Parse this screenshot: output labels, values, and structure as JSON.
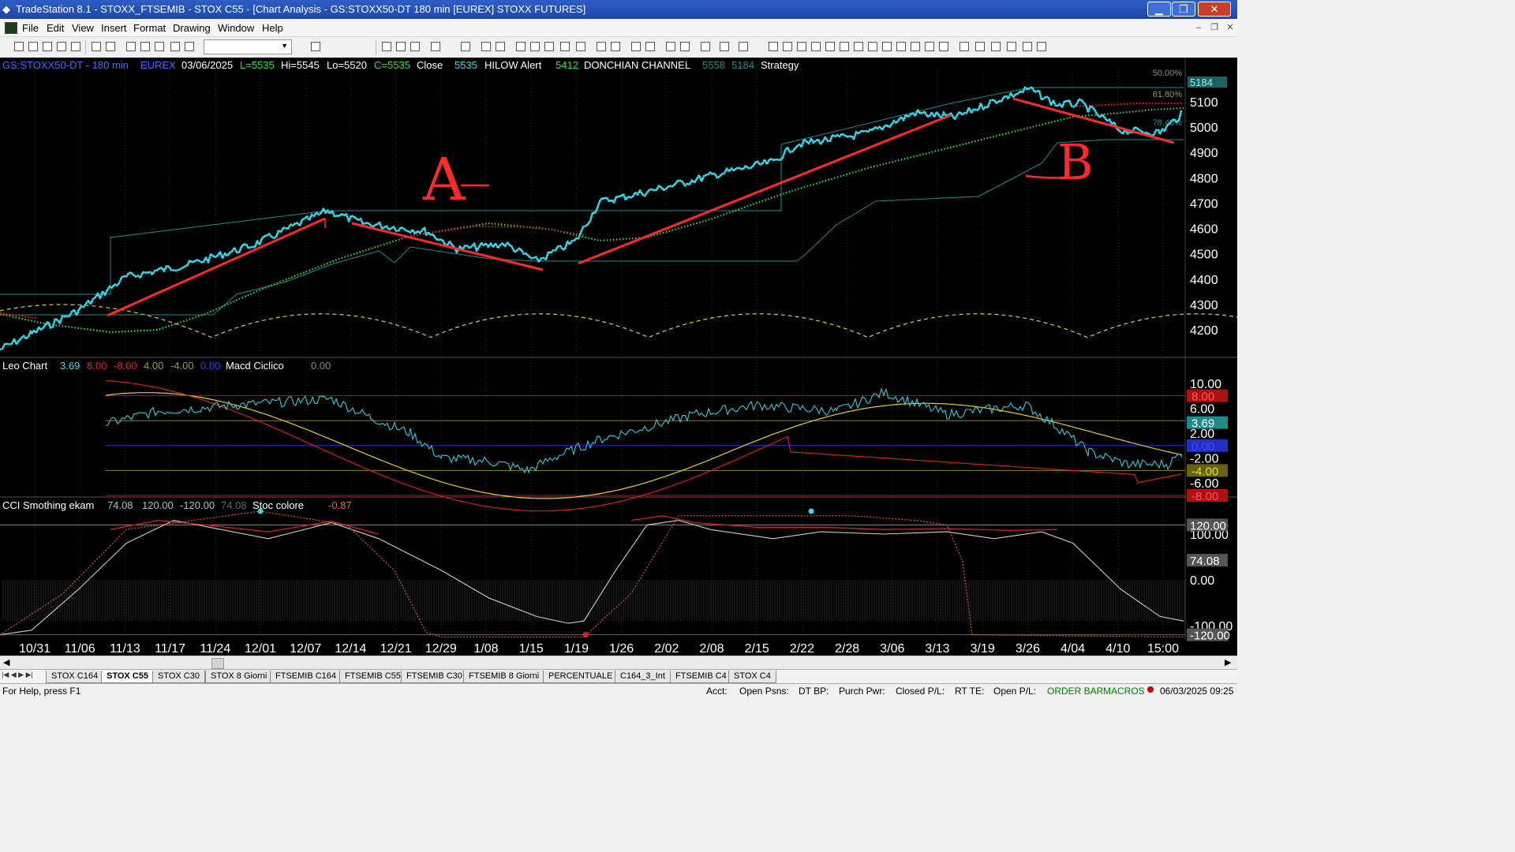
{
  "window": {
    "title": "TradeStation 8.1 - STOXX_FTSEMIB - STOX C55 - [Chart Analysis - GS:STOXX50-DT  180 min  [EUREX] STOXX FUTURES]",
    "minimize": "▁",
    "restore": "❐",
    "close": "✕"
  },
  "menu": {
    "items": [
      "File",
      "Edit",
      "View",
      "Insert",
      "Format",
      "Drawing",
      "Window",
      "Help"
    ],
    "mdi_min": "–",
    "mdi_restore": "❐",
    "mdi_close": "✕"
  },
  "chart": {
    "header": {
      "symbol": "GS:STOXX50-DT - 180 min",
      "exchange": "EUREX",
      "date": "03/06/2025",
      "last": "L=5535",
      "high": "Hi=5545",
      "low": "Lo=5520",
      "close": "C=5535",
      "close_label": "Close",
      "close_value": "5535",
      "hilow_label": "HILOW Alert",
      "hilow_value": "5412",
      "donchian_label": "DONCHIAN CHANNEL",
      "donchian_upper": "5558",
      "donchian_lower": "5184",
      "strategy_label": "Strategy"
    },
    "price_axis": [
      "5100",
      "5000",
      "4900",
      "4800",
      "4700",
      "4600",
      "4500",
      "4400",
      "4300",
      "4200"
    ],
    "fib_labels": [
      "50.00%",
      "61.80%",
      "78.40%"
    ],
    "last_price_tag": "5184",
    "annotations": [
      "A",
      "B"
    ],
    "colors": {
      "price": "#34d8e8",
      "trendline": "#ff2a2a",
      "ma_green": "#30e030",
      "ma_red": "#e02020",
      "cycle": "#e0d020",
      "donchian": "#1f8c8c"
    }
  },
  "panel2": {
    "name": "Leo Chart",
    "v1": "3.69",
    "v2": "8.00",
    "v3": "-8.00",
    "v4": "4.00",
    "v5": "-4.00",
    "v6": "0.00",
    "macd_label": "Macd Ciclico",
    "macd_value": "0.00",
    "axis": [
      "10.00",
      "6.00",
      "2.00",
      "-2.00",
      "-6.00"
    ],
    "tags": [
      "8.00",
      "3.69",
      "0.00",
      "-4.00",
      "-8.00"
    ]
  },
  "panel3": {
    "name": "CCI Smothing ekam",
    "v1": "74.08",
    "v2": "120.00",
    "v3": "-120.00",
    "v4": "74.08",
    "stoc_label": "Stoc colore",
    "stoc_value": "-0.87",
    "axis": [
      "120.00",
      "100.00",
      "0.00",
      "-100.00"
    ],
    "tags": [
      "120.00",
      "74.08",
      "-120.00"
    ]
  },
  "date_axis": [
    "10/31",
    "11/06",
    "11/13",
    "11/17",
    "11/24",
    "12/01",
    "12/07",
    "12/14",
    "12/21",
    "12/29",
    "1/08",
    "1/15",
    "1/19",
    "1/26",
    "2/02",
    "2/08",
    "2/15",
    "2/22",
    "2/28",
    "3/06",
    "3/13",
    "3/19",
    "3/26",
    "4/04",
    "4/10",
    "15:00"
  ],
  "tabs": [
    "STOX C164",
    "STOX C55",
    "STOX C30",
    "STOX 8 Giorni",
    "FTSEMIB C164",
    "FTSEMIB C55",
    "FTSEMIB C30",
    "FTSEMIB 8 Giorni",
    "PERCENTUALE",
    "C164_3_Int",
    "FTSEMIB C4",
    "STOX C4"
  ],
  "active_tab": "STOX C55",
  "status": {
    "help": "For Help, press F1",
    "acct": "Acct:",
    "open_psns": "Open Psns:",
    "dt_bp": "DT BP:",
    "purch_pwr": "Purch Pwr:",
    "closed_pl": "Closed P/L:",
    "rt_te": "RT TE:",
    "open_pl": "Open P/L:",
    "order_bar": "ORDER BAR",
    "macros": "MACROS",
    "datetime": "06/03/2025 09:25"
  }
}
